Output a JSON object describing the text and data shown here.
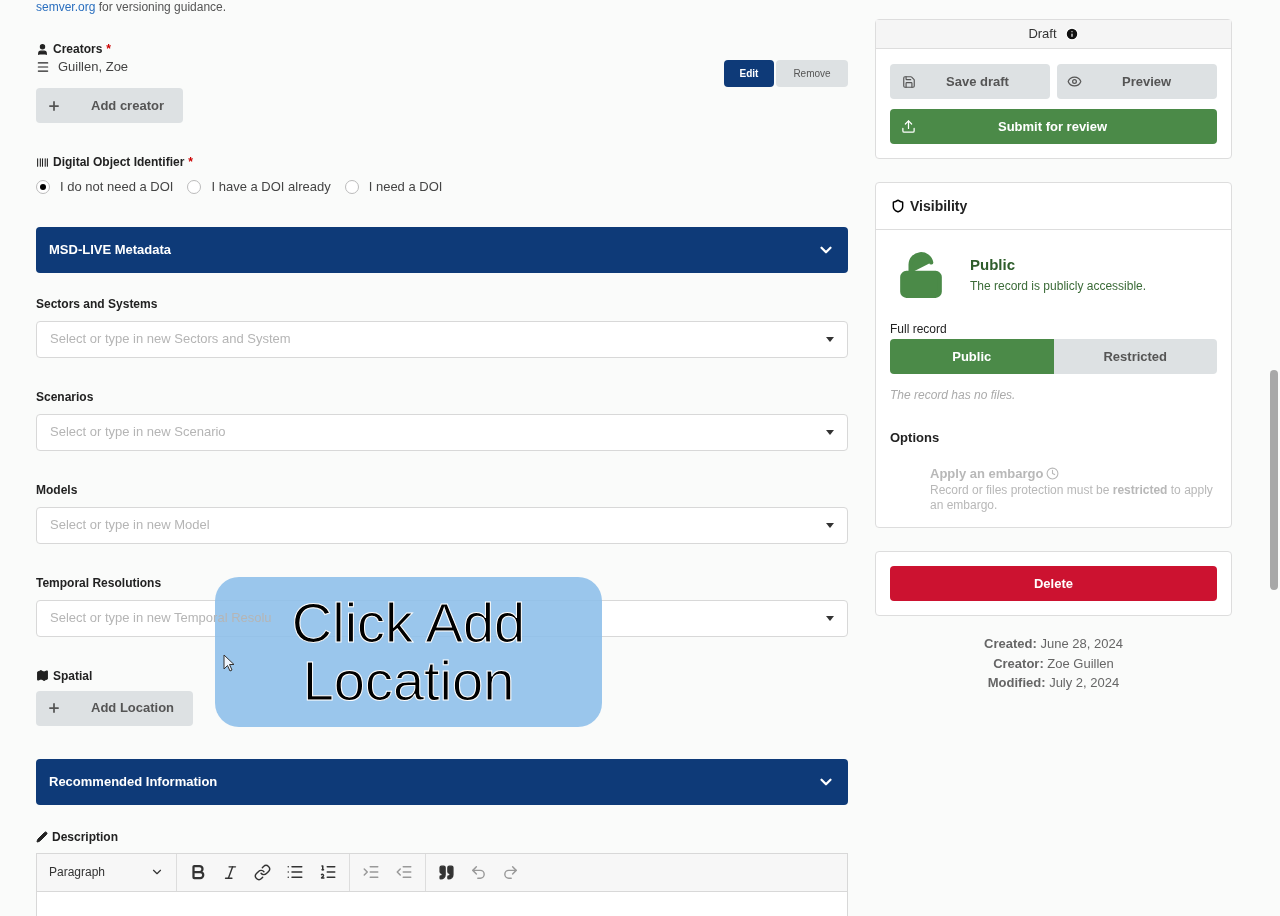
{
  "intro": {
    "link": "semver.org",
    "text": "for versioning guidance."
  },
  "creators": {
    "label": "Creators",
    "required": "*",
    "items": [
      {
        "name": "Guillen, Zoe",
        "edit": "Edit",
        "remove": "Remove"
      }
    ],
    "add_button": "Add creator"
  },
  "doi": {
    "label": "Digital Object Identifier",
    "required": "*",
    "options": [
      {
        "label": "I do not need a DOI",
        "selected": true
      },
      {
        "label": "I have a DOI already",
        "selected": false
      },
      {
        "label": "I need a DOI",
        "selected": false
      }
    ]
  },
  "msd_section": {
    "title": "MSD-LIVE Metadata"
  },
  "msd_fields": [
    {
      "label": "Sectors and Systems",
      "placeholder": "Select or type in new Sectors and System"
    },
    {
      "label": "Scenarios",
      "placeholder": "Select or type in new Scenario"
    },
    {
      "label": "Models",
      "placeholder": "Select or type in new Model"
    },
    {
      "label": "Temporal Resolutions",
      "placeholder": "Select or type in new Temporal Resolu"
    }
  ],
  "spatial": {
    "label": "Spatial",
    "add_button": "Add Location"
  },
  "recommended_section": {
    "title": "Recommended Information"
  },
  "description": {
    "label": "Description",
    "block_style": "Paragraph"
  },
  "callout": {
    "text": "Click Add Location"
  },
  "sidebar": {
    "status": "Draft",
    "save_button": "Save draft",
    "preview_button": "Preview",
    "submit_button": "Submit for review",
    "visibility": {
      "title": "Visibility",
      "state": "Public",
      "state_text": "The record is publicly accessible.",
      "full_record_label": "Full record",
      "options": [
        {
          "label": "Public",
          "selected": true
        },
        {
          "label": "Restricted",
          "selected": false
        }
      ],
      "note": "The record has no files.",
      "options_title": "Options",
      "embargo": {
        "title": "Apply an embargo",
        "text": "Record or files protection must be **restricted** to apply an embargo.",
        "disabled": true
      }
    },
    "delete_button": "Delete",
    "meta": [
      "**Created:** June 28, 2024",
      "**Creator:** Zoe Guillen",
      "**Modified:** July 2, 2024"
    ]
  }
}
